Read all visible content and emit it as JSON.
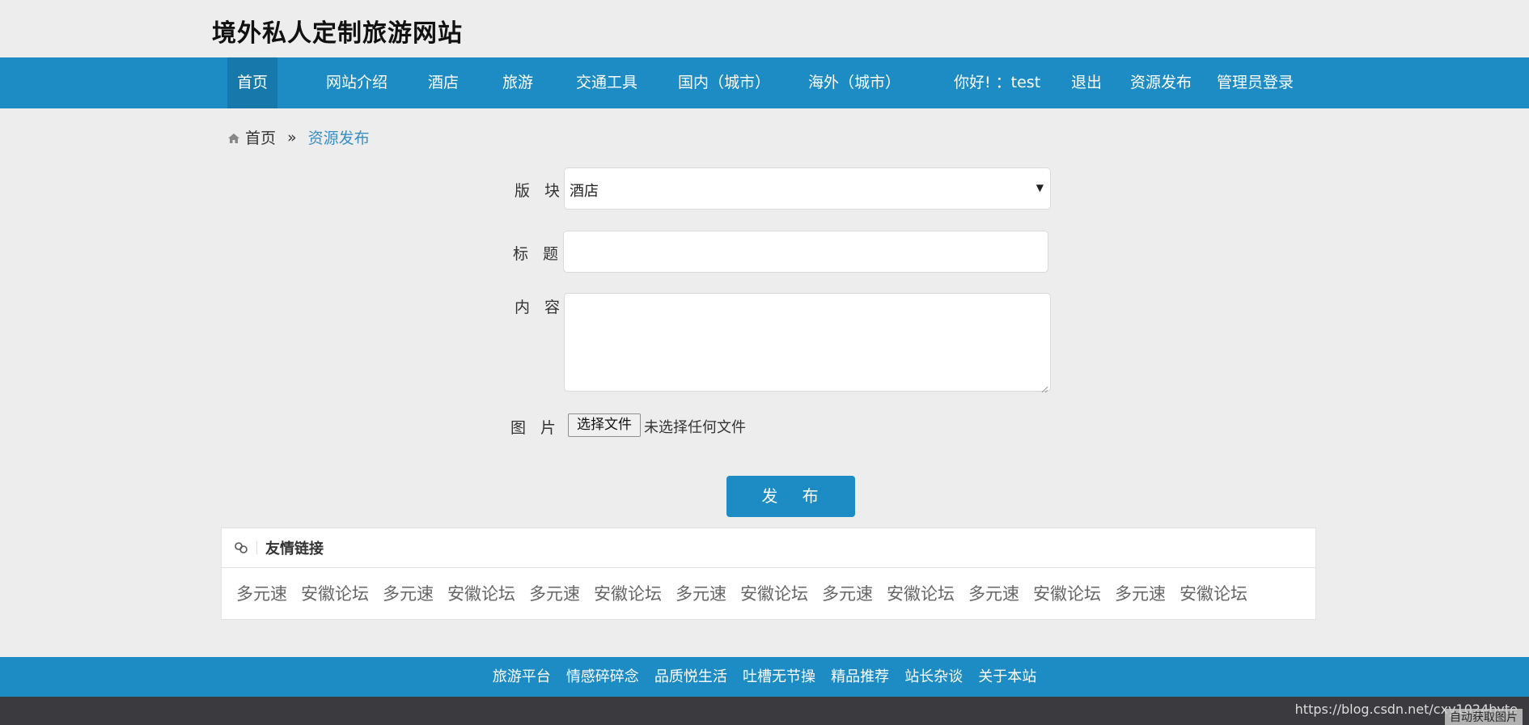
{
  "header": {
    "site_title": "境外私人定制旅游网站"
  },
  "nav": {
    "items": [
      {
        "label": "首页",
        "active": true
      },
      {
        "label": "网站介绍"
      },
      {
        "label": "酒店"
      },
      {
        "label": "旅游"
      },
      {
        "label": "交通工具"
      },
      {
        "label": "国内（城市）"
      },
      {
        "label": "海外（城市）"
      },
      {
        "label": "你好! ：test"
      },
      {
        "label": "退出"
      },
      {
        "label": "资源发布"
      },
      {
        "label": "管理员登录"
      }
    ]
  },
  "breadcrumb": {
    "home": "首页",
    "separator": "»",
    "current": "资源发布"
  },
  "form": {
    "section_label": "版 块",
    "section_value": "酒店",
    "title_label": "标 题",
    "title_value": "",
    "content_label": "内 容",
    "content_value": "",
    "image_label": "图 片",
    "file_button": "选择文件",
    "file_status": "未选择任何文件",
    "submit": "发 布"
  },
  "friend_links": {
    "title": "友情链接",
    "items": [
      "多元速",
      "安徽论坛",
      "多元速",
      "安徽论坛",
      "多元速",
      "安徽论坛",
      "多元速",
      "安徽论坛",
      "多元速",
      "安徽论坛",
      "多元速",
      "安徽论坛",
      "多元速",
      "安徽论坛"
    ]
  },
  "footer": {
    "links": [
      "旅游平台",
      "情感碎碎念",
      "品质悦生活",
      "吐槽无节操",
      "精品推荐",
      "站长杂谈",
      "关于本站"
    ],
    "watermark": "https://blog.csdn.net/cxy1024byte",
    "auto_image": "自动获取图片"
  },
  "colors": {
    "brand": "#1d8bc4",
    "active_nav": "#1678ab",
    "footer_dark": "#3a3a3f"
  },
  "icons": {
    "home": "home-icon",
    "links": "link-icon",
    "select": "chevron-down-icon"
  }
}
